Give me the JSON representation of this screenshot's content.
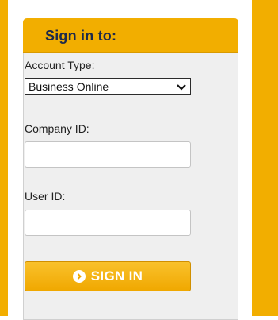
{
  "colors": {
    "accent": "#f2ae00",
    "panel_bg": "#efefef",
    "title_text": "#1e2a4a"
  },
  "signin_panel": {
    "title": "Sign in to:",
    "account_type": {
      "label": "Account Type:",
      "selected": "Business Online"
    },
    "company_id": {
      "label": "Company ID:",
      "value": ""
    },
    "user_id": {
      "label": "User ID:",
      "value": ""
    },
    "submit": {
      "label": "SIGN IN",
      "icon": "chevron-right-circle-icon"
    },
    "select_icon": "chevron-down-icon"
  }
}
